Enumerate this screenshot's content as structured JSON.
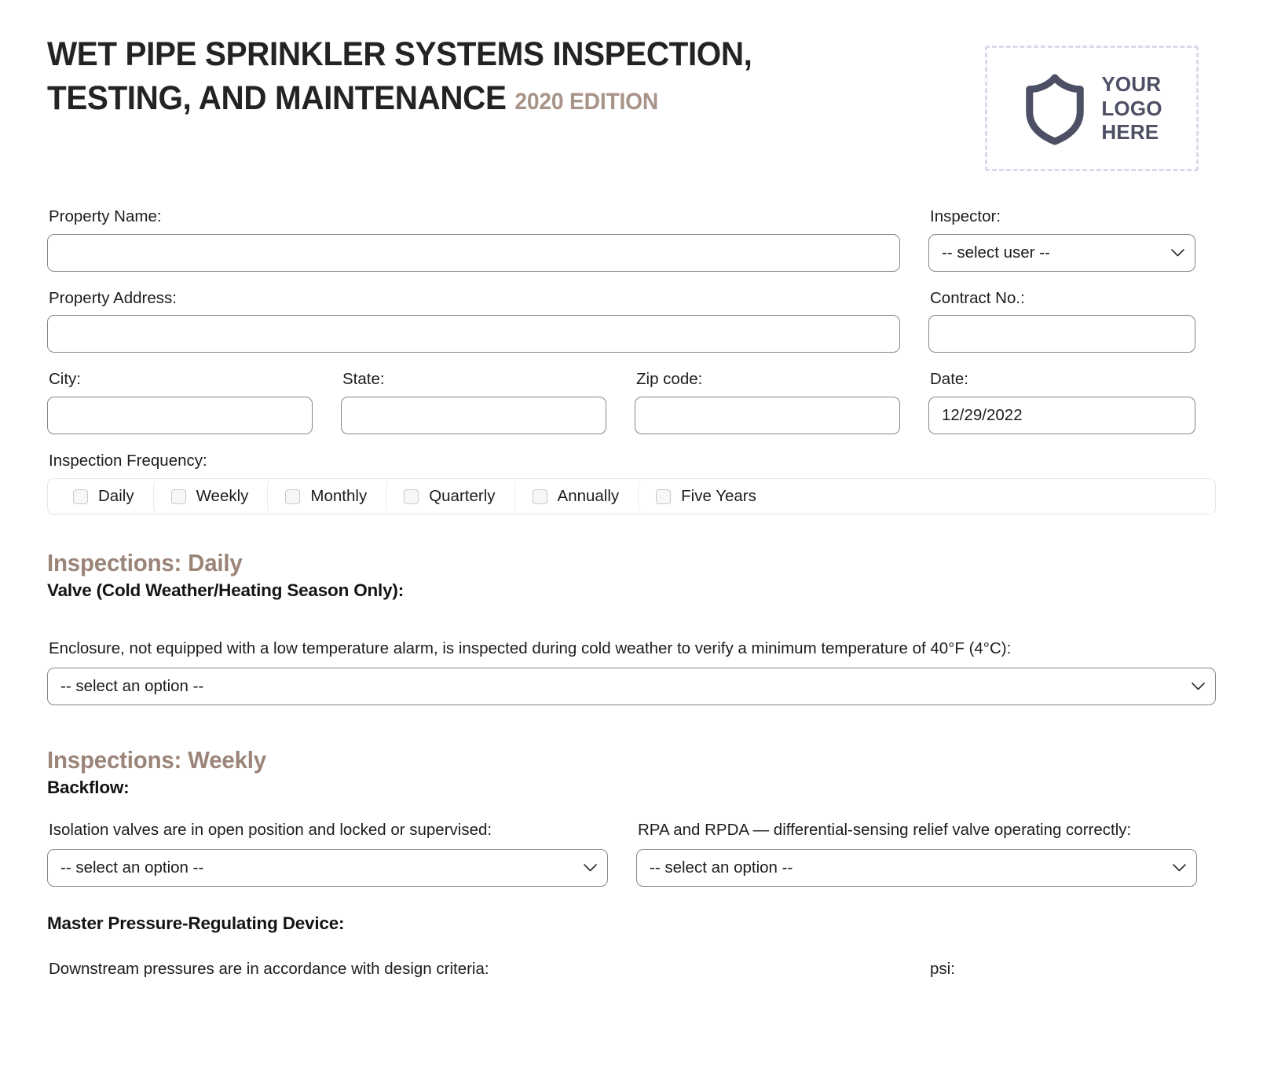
{
  "header": {
    "title_line1": "WET PIPE SPRINKLER SYSTEMS INSPECTION,",
    "title_line2": "TESTING, AND MAINTENANCE",
    "edition": "2020 Edition",
    "logo": {
      "icon": "shield-icon",
      "line1": "YOUR",
      "line2": "LOGO",
      "line3": "HERE"
    }
  },
  "form": {
    "property_name": {
      "label": "Property Name:",
      "value": "",
      "placeholder": ""
    },
    "inspector": {
      "label": "Inspector:",
      "value": "-- select user --"
    },
    "property_address": {
      "label": "Property Address:",
      "value": "",
      "placeholder": ""
    },
    "contract_no": {
      "label": "Contract No.:",
      "value": "",
      "placeholder": ""
    },
    "city": {
      "label": "City:",
      "value": "",
      "placeholder": ""
    },
    "state": {
      "label": "State:",
      "value": "",
      "placeholder": ""
    },
    "zip_code": {
      "label": "Zip code:",
      "value": "",
      "placeholder": ""
    },
    "date": {
      "label": "Date:",
      "value": "12/29/2022"
    },
    "inspection_frequency": {
      "label": "Inspection Frequency:",
      "options": [
        {
          "label": "Daily",
          "checked": false
        },
        {
          "label": "Weekly",
          "checked": false
        },
        {
          "label": "Monthly",
          "checked": false
        },
        {
          "label": "Quarterly",
          "checked": false
        },
        {
          "label": "Annually",
          "checked": false
        },
        {
          "label": "Five Years",
          "checked": false
        }
      ]
    }
  },
  "sections": {
    "daily": {
      "heading": "Inspections: Daily",
      "sub_heading": "Valve (Cold Weather/Heating Season Only):",
      "question": "Enclosure, not equipped with a low temperature alarm, is inspected during cold weather to verify a minimum temperature of 40°F (4°C):",
      "answer": "-- select an option --"
    },
    "weekly": {
      "heading": "Inspections: Weekly",
      "backflow": {
        "sub_heading": "Backflow:",
        "q1": {
          "question": "Isolation valves are in open position and locked or supervised:",
          "answer": "-- select an option --"
        },
        "q2": {
          "question": "RPA and RPDA — differential-sensing relief valve operating correctly:",
          "answer": "-- select an option --"
        }
      },
      "master_prd": {
        "sub_heading": "Master Pressure-Regulating Device:",
        "q1": {
          "question": "Downstream pressures are in accordance with design criteria:"
        },
        "q2": {
          "question": "psi:"
        }
      }
    }
  },
  "colors": {
    "accent_taupe": "#9b8478",
    "logo_slate": "#4d5064",
    "logo_dash": "#d7dce8",
    "input_border": "#878787"
  }
}
